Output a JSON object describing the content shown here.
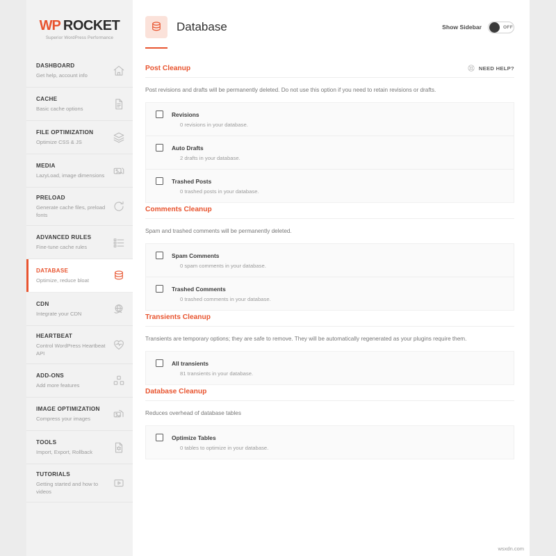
{
  "brand": {
    "name_primary": "WP",
    "name_secondary": "ROCKET",
    "tagline": "Superior WordPress Performance"
  },
  "colors": {
    "accent": "#e8542f",
    "sidebar_bg": "#f2f2f2",
    "panel_bg": "#ffffff",
    "option_bg": "#fafafa"
  },
  "sidebar": {
    "items": [
      {
        "title": "DASHBOARD",
        "subtitle": "Get help, account info",
        "icon": "home-icon",
        "active": false
      },
      {
        "title": "CACHE",
        "subtitle": "Basic cache options",
        "icon": "document-icon",
        "active": false
      },
      {
        "title": "FILE OPTIMIZATION",
        "subtitle": "Optimize CSS & JS",
        "icon": "layers-icon",
        "active": false
      },
      {
        "title": "MEDIA",
        "subtitle": "LazyLoad, image dimensions",
        "icon": "images-icon",
        "active": false
      },
      {
        "title": "PRELOAD",
        "subtitle": "Generate cache files, preload fonts",
        "icon": "refresh-icon",
        "active": false
      },
      {
        "title": "ADVANCED RULES",
        "subtitle": "Fine-tune cache rules",
        "icon": "list-icon",
        "active": false
      },
      {
        "title": "DATABASE",
        "subtitle": "Optimize, reduce bloat",
        "icon": "database-icon",
        "active": true
      },
      {
        "title": "CDN",
        "subtitle": "Integrate your CDN",
        "icon": "globe-icon",
        "active": false
      },
      {
        "title": "HEARTBEAT",
        "subtitle": "Control WordPress Heartbeat API",
        "icon": "heart-icon",
        "active": false
      },
      {
        "title": "ADD-ONS",
        "subtitle": "Add more features",
        "icon": "blocks-icon",
        "active": false
      },
      {
        "title": "IMAGE OPTIMIZATION",
        "subtitle": "Compress your images",
        "icon": "photos-icon",
        "active": false
      },
      {
        "title": "TOOLS",
        "subtitle": "Import, Export, Rollback",
        "icon": "gear-document-icon",
        "active": false
      },
      {
        "title": "TUTORIALS",
        "subtitle": "Getting started and how to videos",
        "icon": "play-icon",
        "active": false
      }
    ]
  },
  "header": {
    "title": "Database",
    "icon": "database-icon",
    "sidebar_toggle_label": "Show Sidebar",
    "sidebar_toggle_state": "OFF"
  },
  "need_help": {
    "label": "NEED HELP?",
    "icon": "lifebuoy-icon"
  },
  "sections": [
    {
      "title": "Post Cleanup",
      "description": "Post revisions and drafts will be permanently deleted. Do not use this option if you need to retain revisions or drafts.",
      "has_need_help": true,
      "options": [
        {
          "label": "Revisions",
          "note": "0 revisions in your database.",
          "checked": false
        },
        {
          "label": "Auto Drafts",
          "note": "2 drafts in your database.",
          "checked": false
        },
        {
          "label": "Trashed Posts",
          "note": "0 trashed posts in your database.",
          "checked": false
        }
      ]
    },
    {
      "title": "Comments Cleanup",
      "description": "Spam and trashed comments will be permanently deleted.",
      "has_need_help": false,
      "options": [
        {
          "label": "Spam Comments",
          "note": "0 spam comments in your database.",
          "checked": false
        },
        {
          "label": "Trashed Comments",
          "note": "0 trashed comments in your database.",
          "checked": false
        }
      ]
    },
    {
      "title": "Transients Cleanup",
      "description": "Transients are temporary options; they are safe to remove. They will be automatically regenerated as your plugins require them.",
      "has_need_help": false,
      "options": [
        {
          "label": "All transients",
          "note": "81 transients in your database.",
          "checked": false
        }
      ]
    },
    {
      "title": "Database Cleanup",
      "description": "Reduces overhead of database tables",
      "has_need_help": false,
      "options": [
        {
          "label": "Optimize Tables",
          "note": "0 tables to optimize in your database.",
          "checked": false
        }
      ]
    }
  ],
  "watermark": "wsxdn.com"
}
